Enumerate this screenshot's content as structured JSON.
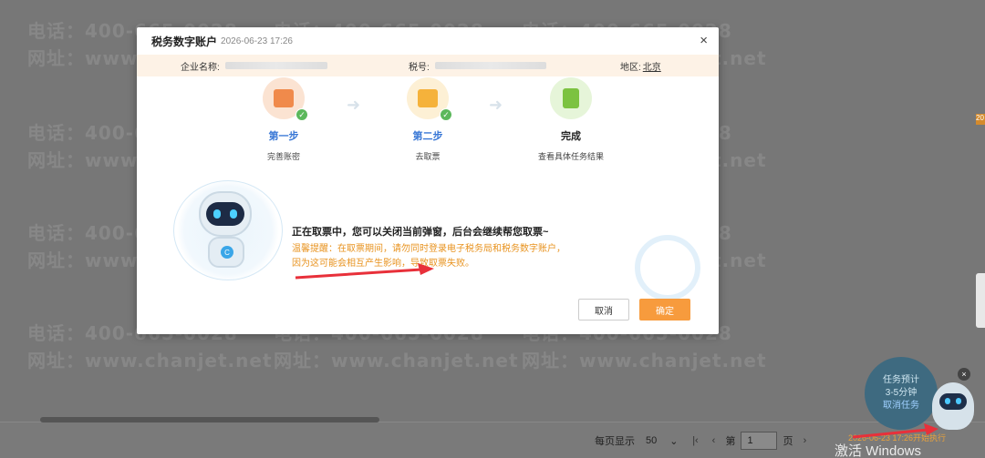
{
  "background": {
    "watermark_phone": "电话：400-665-0028",
    "watermark_site": "网址：www.chanjet.net",
    "pager": {
      "per_page_label": "每页显示",
      "per_page_value": "50",
      "page_prefix": "第",
      "page_value": "1",
      "page_suffix": "页"
    },
    "windows_activate": "激活 Windows",
    "task_widget": {
      "line1": "任务预计",
      "line2": "3-5分钟",
      "link": "取消任务"
    },
    "task_text": "2026-06-23 17:26开始执行",
    "side_badge": "20"
  },
  "dialog": {
    "title": "税务数字账户",
    "timestamp": "2026-06-23 17:26",
    "close_glyph": "×",
    "company_label": "企业名称:",
    "tax_label": "税号:",
    "region_label": "地区:",
    "region_value": "北京",
    "steps": [
      {
        "title": "第一步",
        "desc": "完善账密",
        "done": true
      },
      {
        "title": "第二步",
        "desc": "去取票",
        "done": true
      },
      {
        "title": "完成",
        "desc": "查看具体任务结果",
        "done": false
      }
    ],
    "message_main": "正在取票中，您可以关闭当前弹窗，后台会继续帮您取票~",
    "message_warn": "温馨提醒：在取票期间，请勿同时登录电子税务局和税务数字账户，因为这可能会相互产生影响，导致取票失败。",
    "cancel_label": "取消",
    "ok_label": "确定",
    "check_glyph": "✓",
    "arrow_glyph": "➜",
    "robot_logo": "C"
  },
  "colors": {
    "accent": "#f79b3d",
    "step_blue": "#3a78d6",
    "warn": "#e8931f",
    "success": "#5cb85c"
  }
}
